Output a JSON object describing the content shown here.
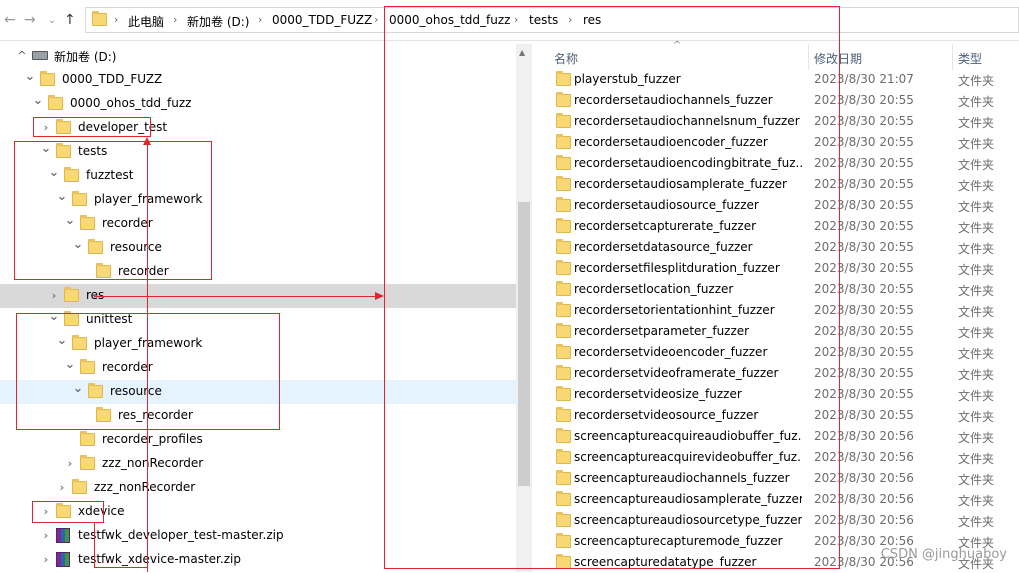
{
  "address_bar": {
    "crumbs": [
      "此电脑",
      "新加卷 (D:)",
      "0000_TDD_FUZZ",
      "0000_ohos_tdd_fuzz",
      "tests",
      "res"
    ]
  },
  "tree": [
    {
      "label": "新加卷 (D:)",
      "indent": 0,
      "chevron": "expanded-up",
      "icon": "drive"
    },
    {
      "label": "0000_TDD_FUZZ",
      "indent": 1,
      "chevron": "expanded",
      "icon": "folder"
    },
    {
      "label": "0000_ohos_tdd_fuzz",
      "indent": 2,
      "chevron": "expanded",
      "icon": "folder"
    },
    {
      "label": "developer_test",
      "indent": 3,
      "chevron": "collapsed",
      "icon": "folder"
    },
    {
      "label": "tests",
      "indent": 3,
      "chevron": "expanded",
      "icon": "folder"
    },
    {
      "label": "fuzztest",
      "indent": 4,
      "chevron": "expanded",
      "icon": "folder"
    },
    {
      "label": "player_framework",
      "indent": 5,
      "chevron": "expanded",
      "icon": "folder"
    },
    {
      "label": "recorder",
      "indent": 6,
      "chevron": "expanded",
      "icon": "folder"
    },
    {
      "label": "resource",
      "indent": 7,
      "chevron": "expanded",
      "icon": "folder"
    },
    {
      "label": "recorder",
      "indent": 8,
      "chevron": "none",
      "icon": "folder"
    },
    {
      "label": "res",
      "indent": 4,
      "chevron": "collapsed",
      "icon": "folder",
      "state": "selected"
    },
    {
      "label": "unittest",
      "indent": 4,
      "chevron": "expanded",
      "icon": "folder"
    },
    {
      "label": "player_framework",
      "indent": 5,
      "chevron": "expanded",
      "icon": "folder"
    },
    {
      "label": "recorder",
      "indent": 6,
      "chevron": "expanded",
      "icon": "folder"
    },
    {
      "label": "resource",
      "indent": 7,
      "chevron": "expanded",
      "icon": "folder",
      "state": "hover"
    },
    {
      "label": "res_recorder",
      "indent": 8,
      "chevron": "none",
      "icon": "folder"
    },
    {
      "label": "recorder_profiles",
      "indent": 6,
      "chevron": "none",
      "icon": "folder"
    },
    {
      "label": "zzz_nonRecorder",
      "indent": 6,
      "chevron": "collapsed",
      "icon": "folder"
    },
    {
      "label": "zzz_nonRecorder",
      "indent": 5,
      "chevron": "collapsed",
      "icon": "folder"
    },
    {
      "label": "xdevice",
      "indent": 3,
      "chevron": "collapsed",
      "icon": "folder"
    },
    {
      "label": "testfwk_developer_test-master.zip",
      "indent": 3,
      "chevron": "collapsed",
      "icon": "zip"
    },
    {
      "label": "testfwk_xdevice-master.zip",
      "indent": 3,
      "chevron": "collapsed",
      "icon": "zip"
    }
  ],
  "list_header": {
    "name": "名称",
    "date": "修改日期",
    "type": "类型"
  },
  "files": [
    {
      "name": "playerstub_fuzzer",
      "date": "2023/8/30 21:07",
      "type": "文件夹"
    },
    {
      "name": "recordersetaudiochannels_fuzzer",
      "date": "2023/8/30 20:55",
      "type": "文件夹"
    },
    {
      "name": "recordersetaudiochannelsnum_fuzzer",
      "date": "2023/8/30 20:55",
      "type": "文件夹"
    },
    {
      "name": "recordersetaudioencoder_fuzzer",
      "date": "2023/8/30 20:55",
      "type": "文件夹"
    },
    {
      "name": "recordersetaudioencodingbitrate_fuz...",
      "date": "2023/8/30 20:55",
      "type": "文件夹"
    },
    {
      "name": "recordersetaudiosamplerate_fuzzer",
      "date": "2023/8/30 20:55",
      "type": "文件夹"
    },
    {
      "name": "recordersetaudiosource_fuzzer",
      "date": "2023/8/30 20:55",
      "type": "文件夹"
    },
    {
      "name": "recordersetcapturerate_fuzzer",
      "date": "2023/8/30 20:55",
      "type": "文件夹"
    },
    {
      "name": "recordersetdatasource_fuzzer",
      "date": "2023/8/30 20:55",
      "type": "文件夹"
    },
    {
      "name": "recordersetfilesplitduration_fuzzer",
      "date": "2023/8/30 20:55",
      "type": "文件夹"
    },
    {
      "name": "recordersetlocation_fuzzer",
      "date": "2023/8/30 20:55",
      "type": "文件夹"
    },
    {
      "name": "recordersetorientationhint_fuzzer",
      "date": "2023/8/30 20:55",
      "type": "文件夹"
    },
    {
      "name": "recordersetparameter_fuzzer",
      "date": "2023/8/30 20:55",
      "type": "文件夹"
    },
    {
      "name": "recordersetvideoencoder_fuzzer",
      "date": "2023/8/30 20:55",
      "type": "文件夹"
    },
    {
      "name": "recordersetvideoframerate_fuzzer",
      "date": "2023/8/30 20:55",
      "type": "文件夹"
    },
    {
      "name": "recordersetvideosize_fuzzer",
      "date": "2023/8/30 20:55",
      "type": "文件夹"
    },
    {
      "name": "recordersetvideosource_fuzzer",
      "date": "2023/8/30 20:55",
      "type": "文件夹"
    },
    {
      "name": "screencaptureacquireaudiobuffer_fuz...",
      "date": "2023/8/30 20:56",
      "type": "文件夹"
    },
    {
      "name": "screencaptureacquirevideobuffer_fuz...",
      "date": "2023/8/30 20:56",
      "type": "文件夹"
    },
    {
      "name": "screencaptureaudiochannels_fuzzer",
      "date": "2023/8/30 20:56",
      "type": "文件夹"
    },
    {
      "name": "screencaptureaudiosamplerate_fuzzer",
      "date": "2023/8/30 20:56",
      "type": "文件夹"
    },
    {
      "name": "screencaptureaudiosourcetype_fuzzer",
      "date": "2023/8/30 20:56",
      "type": "文件夹"
    },
    {
      "name": "screencapturecapturemode_fuzzer",
      "date": "2023/8/30 20:56",
      "type": "文件夹"
    },
    {
      "name": "screencapturedatatype_fuzzer",
      "date": "2023/8/30 20:56",
      "type": "文件夹"
    }
  ],
  "watermark": "CSDN @jinghuaboy",
  "colors": {
    "annotation_red": "#e0272e",
    "selected_bg": "#d9d9d9",
    "hover_bg": "#e5f3ff",
    "folder_yellow": "#f8d775"
  }
}
